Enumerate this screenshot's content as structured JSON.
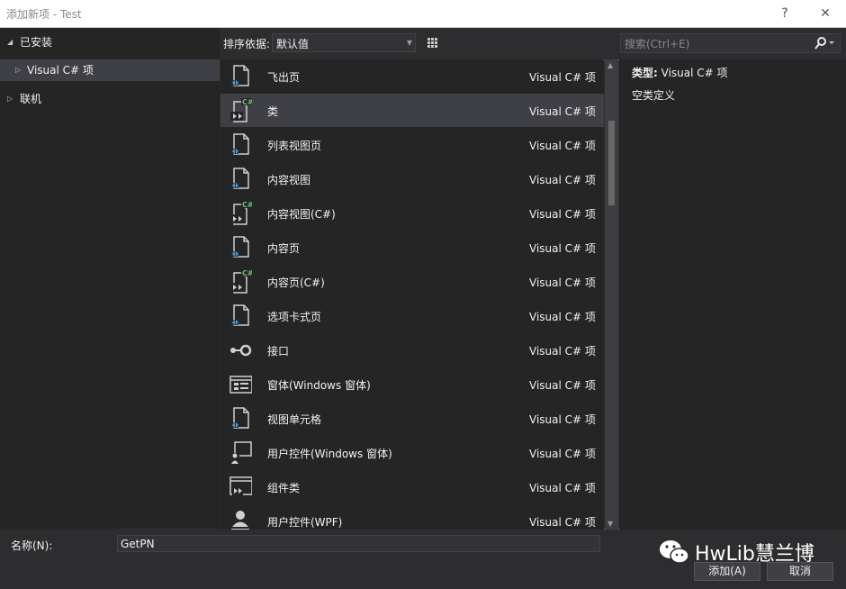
{
  "window": {
    "title": "添加新项 - Test",
    "help_label": "?",
    "close_label": "✕"
  },
  "tree": [
    {
      "label": "已安装",
      "expanded": true
    },
    {
      "label": "Visual C# 项",
      "expanded": false,
      "selected": true
    },
    {
      "label": "联机",
      "expanded": false
    }
  ],
  "toolbar": {
    "sort_label": "排序依据:",
    "sort_value": "默认值"
  },
  "search": {
    "placeholder": "搜索(Ctrl+E)"
  },
  "items": [
    {
      "name": "飞出页",
      "category": "Visual C# 项",
      "icon": "xaml-page-icon"
    },
    {
      "name": "类",
      "category": "Visual C# 项",
      "icon": "csharp-class-icon",
      "selected": true
    },
    {
      "name": "列表视图页",
      "category": "Visual C# 项",
      "icon": "xaml-page-icon"
    },
    {
      "name": "内容视图",
      "category": "Visual C# 项",
      "icon": "xaml-page-icon"
    },
    {
      "name": "内容视图(C#)",
      "category": "Visual C# 项",
      "icon": "csharp-class-icon"
    },
    {
      "name": "内容页",
      "category": "Visual C# 项",
      "icon": "xaml-page-icon"
    },
    {
      "name": "内容页(C#)",
      "category": "Visual C# 项",
      "icon": "csharp-class-icon"
    },
    {
      "name": "选项卡式页",
      "category": "Visual C# 项",
      "icon": "xaml-page-icon"
    },
    {
      "name": "接口",
      "category": "Visual C# 项",
      "icon": "interface-icon"
    },
    {
      "name": "窗体(Windows 窗体)",
      "category": "Visual C# 项",
      "icon": "windows-form-icon"
    },
    {
      "name": "视图单元格",
      "category": "Visual C# 项",
      "icon": "xaml-page-icon"
    },
    {
      "name": "用户控件(Windows 窗体)",
      "category": "Visual C# 项",
      "icon": "user-control-icon"
    },
    {
      "name": "组件类",
      "category": "Visual C# 项",
      "icon": "component-class-icon"
    },
    {
      "name": "用户控件(WPF)",
      "category": "Visual C# 项",
      "icon": "user-control-wpf-icon"
    }
  ],
  "detail": {
    "type_label": "类型:",
    "type_value": "Visual C# 项",
    "description": "空类定义"
  },
  "bottom": {
    "name_label": "名称(N):",
    "name_value": "GetPN",
    "add_label": "添加(A)",
    "cancel_label": "取消"
  },
  "watermark": {
    "text": "HwLib慧兰博"
  },
  "colors": {
    "accent": "#3399ff",
    "csharp_green": "#6fbf73",
    "selection": "#3f3f46"
  }
}
